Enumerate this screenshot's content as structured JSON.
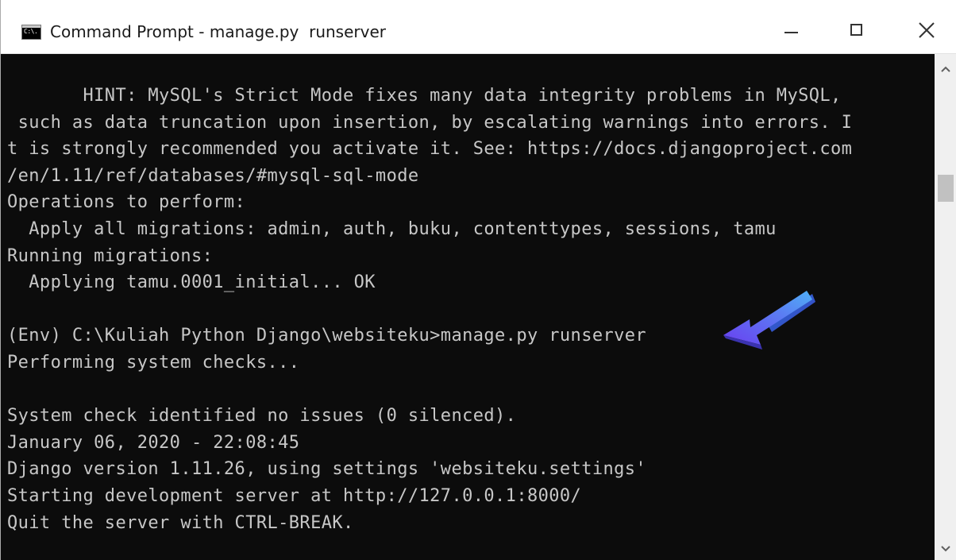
{
  "window": {
    "title": "Command Prompt - manage.py  runserver",
    "icon": "command-prompt-icon",
    "icon_text": "C:\\."
  },
  "controls": {
    "minimize_icon": "minimize-icon",
    "maximize_icon": "maximize-icon",
    "close_icon": "close-icon"
  },
  "console": {
    "lines": [
      "       HINT: MySQL's Strict Mode fixes many data integrity problems in MySQL,",
      " such as data truncation upon insertion, by escalating warnings into errors. I",
      "t is strongly recommended you activate it. See: https://docs.djangoproject.com",
      "/en/1.11/ref/databases/#mysql-sql-mode",
      "Operations to perform:",
      "  Apply all migrations: admin, auth, buku, contenttypes, sessions, tamu",
      "Running migrations:",
      "  Applying tamu.0001_initial... OK",
      "",
      "(Env) C:\\Kuliah Python Django\\websiteku>manage.py runserver",
      "Performing system checks...",
      "",
      "System check identified no issues (0 silenced).",
      "January 06, 2020 - 22:08:45",
      "Django version 1.11.26, using settings 'websiteku.settings'",
      "Starting development server at http://127.0.0.1:8000/",
      "Quit the server with CTRL-BREAK."
    ],
    "text_color": "#c7c7c7",
    "background": "#0c0c0c"
  },
  "annotation": {
    "icon": "pointer-arrow-icon",
    "color": "#6a5cf0"
  },
  "scrollbar": {
    "up_icon": "scroll-up-arrow-icon",
    "down_icon": "scroll-down-arrow-icon"
  }
}
